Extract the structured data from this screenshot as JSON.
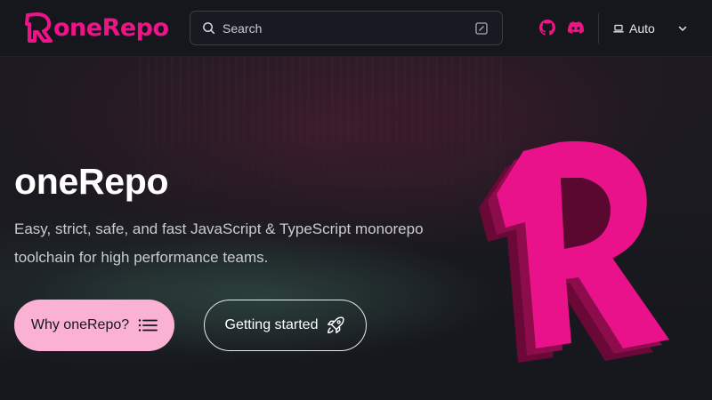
{
  "header": {
    "brand": "oneRepo",
    "search": {
      "placeholder": "Search"
    },
    "social": [
      "github-icon",
      "discord-icon"
    ],
    "theme": {
      "selected": "Auto"
    }
  },
  "hero": {
    "title": "oneRepo",
    "tagline": "Easy, strict, safe, and fast JavaScript & TypeScript monorepo toolchain for high performance teams.",
    "primary_button": "Why oneRepo?",
    "secondary_button": "Getting started"
  },
  "colors": {
    "accent": "#ee1487",
    "primary_button_bg": "#fbb1d3",
    "background": "#15171d"
  }
}
